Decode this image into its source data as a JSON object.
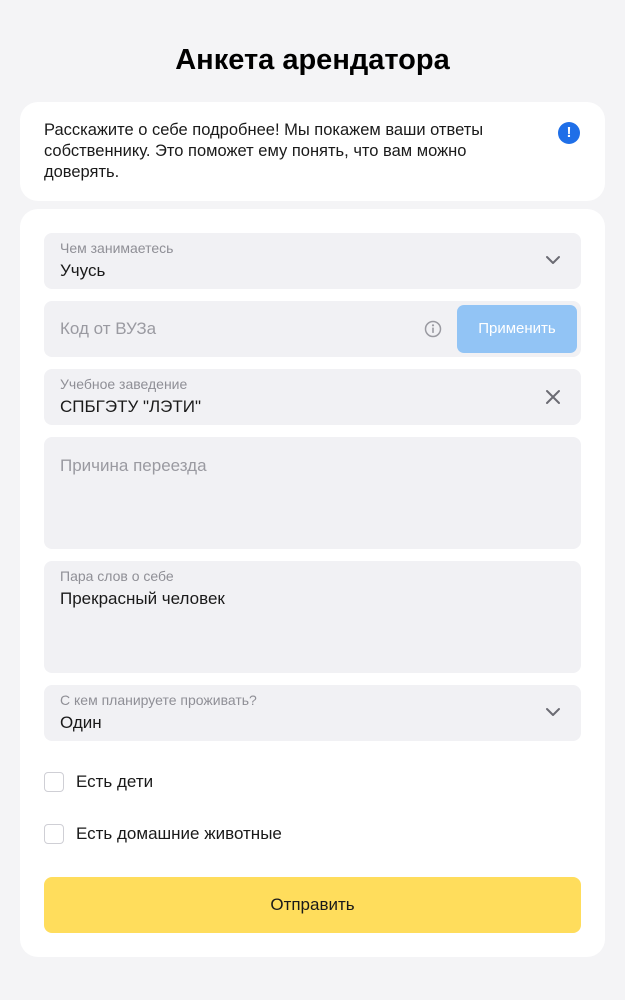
{
  "header": {
    "title": "Анкета арендатора"
  },
  "intro": {
    "text": "Расскажите о себе подробнее! Мы покажем ваши ответы собственнику. Это поможет ему понять, что вам можно доверять.",
    "icon": "exclamation-icon",
    "icon_color": "#1f6fe8"
  },
  "form": {
    "occupation": {
      "label": "Чем занимаетесь",
      "value": "Учусь"
    },
    "university_code": {
      "placeholder": "Код от ВУЗа",
      "apply_label": "Применить"
    },
    "school": {
      "label": "Учебное заведение",
      "value": "СПБГЭТУ \"ЛЭТИ\""
    },
    "move_reason": {
      "placeholder": "Причина переезда"
    },
    "about": {
      "label": "Пара слов о себе",
      "value": "Прекрасный человек"
    },
    "living_with": {
      "label": "С кем планируете проживать?",
      "value": "Один"
    },
    "has_children": {
      "label": "Есть дети",
      "checked": false
    },
    "has_pets": {
      "label": "Есть домашние животные",
      "checked": false
    },
    "submit_label": "Отправить"
  },
  "colors": {
    "background": "#f4f4f6",
    "field": "#f1f1f4",
    "submit": "#ffdd5c",
    "apply_disabled": "#92c4f5"
  }
}
